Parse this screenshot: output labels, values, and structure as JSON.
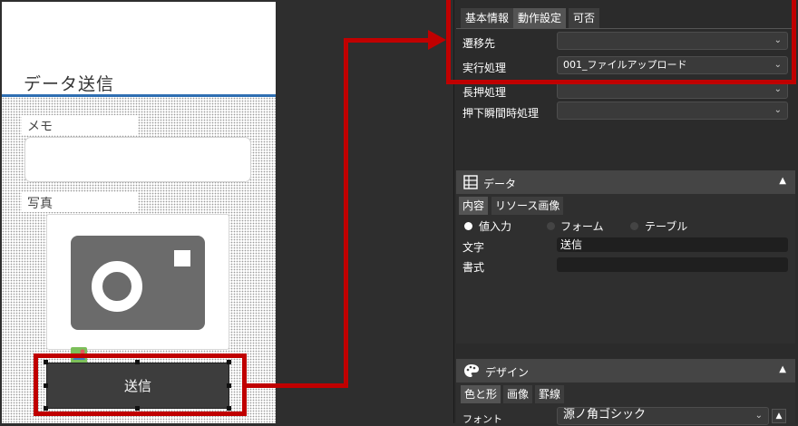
{
  "canvas": {
    "title": "データ送信",
    "memo_label": "メモ",
    "photo_label": "写真",
    "send_button": "送信"
  },
  "props": {
    "tabs": [
      "基本情報",
      "動作設定",
      "可否"
    ],
    "rows": [
      {
        "label": "遷移先",
        "value": ""
      },
      {
        "label": "実行処理",
        "value": "001_ファイルアップロード"
      },
      {
        "label": "長押処理",
        "value": ""
      },
      {
        "label": "押下瞬間時処理",
        "value": ""
      }
    ]
  },
  "data_section": {
    "title": "データ",
    "tabs": [
      "内容",
      "リソース画像"
    ],
    "radios": [
      "値入力",
      "フォーム",
      "テーブル"
    ],
    "selected_radio": "値入力",
    "text_label": "文字",
    "text_value": "送信",
    "format_label": "書式",
    "format_value": ""
  },
  "design_section": {
    "title": "デザイン",
    "tabs": [
      "色と形",
      "画像",
      "罫線"
    ],
    "font_label": "フォント",
    "font_value": "源ノ角ゴシック"
  },
  "colors": {
    "highlight": "#c00000",
    "header_rule": "#2f6fb2",
    "button_bg": "#3d3d3d"
  },
  "icons": [
    "camera-icon",
    "chevron-down-icon",
    "chevron-up-icon",
    "table-icon",
    "palette-icon"
  ]
}
